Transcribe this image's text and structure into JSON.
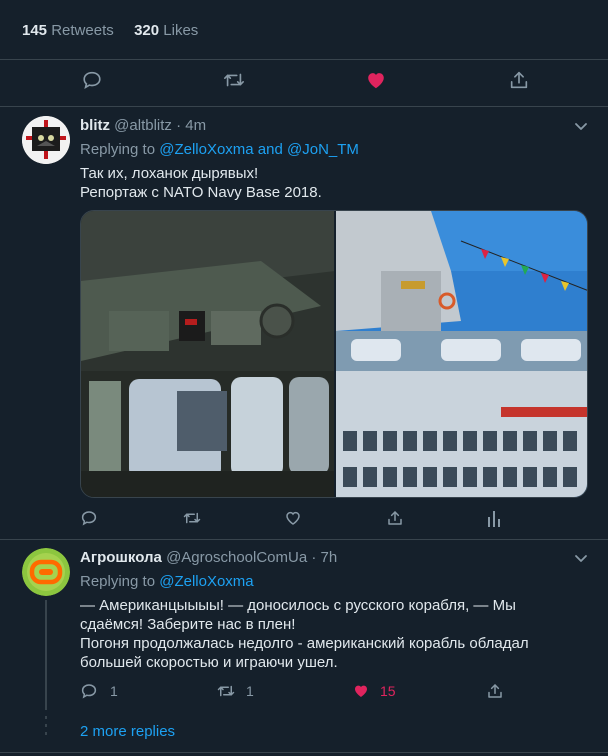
{
  "main_tweet": {
    "retweets_count": "145",
    "retweets_label": "Retweets",
    "likes_count": "320",
    "likes_label": "Likes",
    "liked": true,
    "like_color": "#e0245e"
  },
  "replies": [
    {
      "name": "blitz",
      "handle": "@altblitz",
      "time": "· 4m",
      "replying_prefix": "Replying to",
      "replying_to": "@ZelloXoxma and @JoN_TM",
      "text_lines": [
        "Так их, лоханок дырявых!",
        "Репортаж с NATO Navy Base 2018."
      ],
      "actions": {
        "reply": "",
        "retweet": "",
        "like": ""
      }
    },
    {
      "name": "Агрошкола",
      "handle": "@AgroschoolComUa",
      "time": "· 7h",
      "replying_prefix": "Replying to",
      "replying_to": "@ZelloXoxma",
      "text_lines": [
        "— Американцыыыы! — доносилось с русского корабля, — Мы",
        "сдаёмся! Заберите нас в плен!",
        "Погоня продолжалась недолго - американский корабль обладал",
        "большей скоростью и играючи ушел."
      ],
      "actions": {
        "reply": "1",
        "retweet": "1",
        "like": "15"
      }
    }
  ],
  "more_replies": "2 more replies",
  "colors": {
    "background": "#15202b",
    "accent": "#1da1f2",
    "muted": "#8899a6",
    "like": "#e0245e"
  }
}
